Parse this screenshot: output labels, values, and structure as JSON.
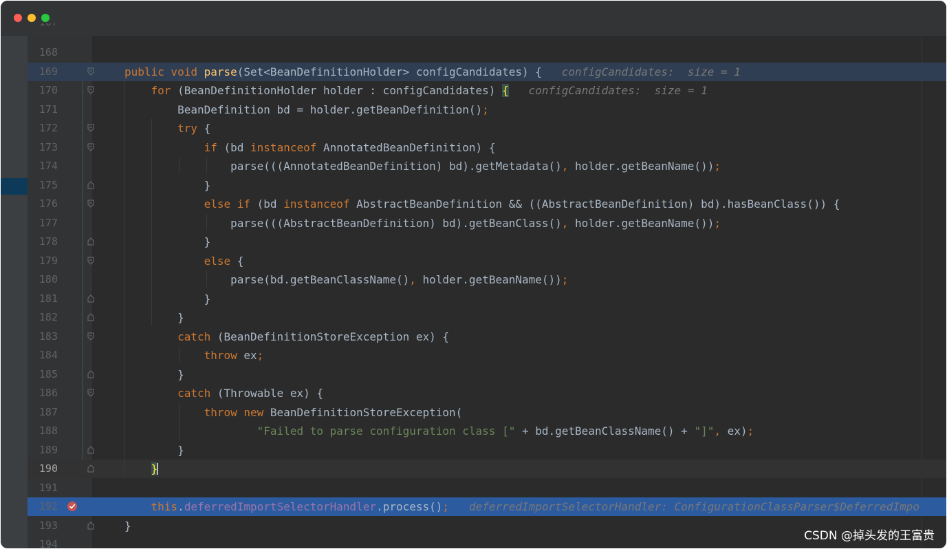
{
  "window": {
    "controls": [
      "close",
      "minimize",
      "zoom"
    ]
  },
  "editor": {
    "lines": [
      {
        "num": "168",
        "state": "normal",
        "fold": "none",
        "segs": []
      },
      {
        "num": "169",
        "state": "method",
        "fold": "open",
        "segs": [
          {
            "t": "public void ",
            "c": "kw"
          },
          {
            "t": "parse",
            "c": "fn"
          },
          {
            "t": "(Set<BeanDefinitionHolder> configCandidates) {   ",
            "c": ""
          },
          {
            "t": "configCandidates:  size = 1",
            "c": "hint"
          }
        ]
      },
      {
        "num": "170",
        "state": "normal",
        "fold": "open",
        "segs": [
          {
            "t": "    for ",
            "c": "kw"
          },
          {
            "t": "(BeanDefinitionHolder holder : configCandidates) ",
            "c": ""
          },
          {
            "t": "{",
            "c": "brace-match"
          },
          {
            "t": "   ",
            "c": ""
          },
          {
            "t": "configCandidates:  size = 1",
            "c": "hint"
          }
        ]
      },
      {
        "num": "171",
        "state": "normal",
        "fold": "none",
        "segs": [
          {
            "t": "        BeanDefinition bd = holder.getBeanDefinition()",
            "c": ""
          },
          {
            "t": ";",
            "c": "kw"
          }
        ]
      },
      {
        "num": "172",
        "state": "normal",
        "fold": "open",
        "segs": [
          {
            "t": "        try ",
            "c": "kw"
          },
          {
            "t": "{",
            "c": ""
          }
        ]
      },
      {
        "num": "173",
        "state": "normal",
        "fold": "open",
        "segs": [
          {
            "t": "            if ",
            "c": "kw"
          },
          {
            "t": "(bd ",
            "c": ""
          },
          {
            "t": "instanceof ",
            "c": "kw"
          },
          {
            "t": "AnnotatedBeanDefinition) {",
            "c": ""
          }
        ]
      },
      {
        "num": "174",
        "state": "normal",
        "fold": "none",
        "segs": [
          {
            "t": "                parse(((AnnotatedBeanDefinition) bd).getMetadata()",
            "c": ""
          },
          {
            "t": ", ",
            "c": "kw"
          },
          {
            "t": "holder.getBeanName())",
            "c": ""
          },
          {
            "t": ";",
            "c": "kw"
          }
        ]
      },
      {
        "num": "175",
        "state": "normal",
        "fold": "close",
        "segs": [
          {
            "t": "            }",
            "c": ""
          }
        ]
      },
      {
        "num": "176",
        "state": "normal",
        "fold": "open",
        "segs": [
          {
            "t": "            else if ",
            "c": "kw"
          },
          {
            "t": "(bd ",
            "c": ""
          },
          {
            "t": "instanceof ",
            "c": "kw"
          },
          {
            "t": "AbstractBeanDefinition && ((AbstractBeanDefinition) bd).hasBeanClass()) {",
            "c": ""
          }
        ]
      },
      {
        "num": "177",
        "state": "normal",
        "fold": "none",
        "segs": [
          {
            "t": "                parse(((AbstractBeanDefinition) bd).getBeanClass()",
            "c": ""
          },
          {
            "t": ", ",
            "c": "kw"
          },
          {
            "t": "holder.getBeanName())",
            "c": ""
          },
          {
            "t": ";",
            "c": "kw"
          }
        ]
      },
      {
        "num": "178",
        "state": "normal",
        "fold": "close",
        "segs": [
          {
            "t": "            }",
            "c": ""
          }
        ]
      },
      {
        "num": "179",
        "state": "normal",
        "fold": "open",
        "segs": [
          {
            "t": "            else ",
            "c": "kw"
          },
          {
            "t": "{",
            "c": ""
          }
        ]
      },
      {
        "num": "180",
        "state": "normal",
        "fold": "none",
        "segs": [
          {
            "t": "                parse(bd.getBeanClassName()",
            "c": ""
          },
          {
            "t": ", ",
            "c": "kw"
          },
          {
            "t": "holder.getBeanName())",
            "c": ""
          },
          {
            "t": ";",
            "c": "kw"
          }
        ]
      },
      {
        "num": "181",
        "state": "normal",
        "fold": "close",
        "segs": [
          {
            "t": "            }",
            "c": ""
          }
        ]
      },
      {
        "num": "182",
        "state": "normal",
        "fold": "close",
        "segs": [
          {
            "t": "        }",
            "c": ""
          }
        ]
      },
      {
        "num": "183",
        "state": "normal",
        "fold": "open",
        "segs": [
          {
            "t": "        catch ",
            "c": "kw"
          },
          {
            "t": "(BeanDefinitionStoreException ex) {",
            "c": ""
          }
        ]
      },
      {
        "num": "184",
        "state": "normal",
        "fold": "none",
        "segs": [
          {
            "t": "            throw ",
            "c": "kw"
          },
          {
            "t": "ex",
            "c": ""
          },
          {
            "t": ";",
            "c": "kw"
          }
        ]
      },
      {
        "num": "185",
        "state": "normal",
        "fold": "close",
        "segs": [
          {
            "t": "        }",
            "c": ""
          }
        ]
      },
      {
        "num": "186",
        "state": "normal",
        "fold": "open",
        "segs": [
          {
            "t": "        catch ",
            "c": "kw"
          },
          {
            "t": "(Throwable ex) {",
            "c": ""
          }
        ]
      },
      {
        "num": "187",
        "state": "normal",
        "fold": "none",
        "segs": [
          {
            "t": "            throw new ",
            "c": "kw"
          },
          {
            "t": "BeanDefinitionStoreException(",
            "c": ""
          }
        ]
      },
      {
        "num": "188",
        "state": "normal",
        "fold": "none",
        "segs": [
          {
            "t": "                    ",
            "c": ""
          },
          {
            "t": "\"Failed to parse configuration class [\"",
            "c": "str"
          },
          {
            "t": " + bd.getBeanClassName() + ",
            "c": ""
          },
          {
            "t": "\"]\"",
            "c": "str"
          },
          {
            "t": ", ",
            "c": "kw"
          },
          {
            "t": "ex)",
            "c": ""
          },
          {
            "t": ";",
            "c": "kw"
          }
        ]
      },
      {
        "num": "189",
        "state": "normal",
        "fold": "close",
        "segs": [
          {
            "t": "        }",
            "c": ""
          }
        ]
      },
      {
        "num": "190",
        "state": "caret",
        "fold": "close",
        "segs": [
          {
            "t": "    ",
            "c": ""
          },
          {
            "t": "}",
            "c": "brace-match"
          },
          {
            "t": "",
            "c": "caret"
          }
        ]
      },
      {
        "num": "191",
        "state": "normal",
        "fold": "none",
        "segs": []
      },
      {
        "num": "192",
        "state": "exec",
        "fold": "none",
        "breakpoint": true,
        "segs": [
          {
            "t": "    this",
            "c": "kw"
          },
          {
            "t": ".",
            "c": ""
          },
          {
            "t": "deferredImportSelectorHandler",
            "c": "fld"
          },
          {
            "t": ".process()",
            "c": ""
          },
          {
            "t": ";",
            "c": "kw"
          },
          {
            "t": "   ",
            "c": ""
          },
          {
            "t": "deferredImportSelectorHandler: ConfigurationClassParser$DeferredImpo",
            "c": "hint"
          }
        ]
      },
      {
        "num": "193",
        "state": "normal",
        "fold": "close",
        "segs": [
          {
            "t": "}",
            "c": ""
          }
        ]
      },
      {
        "num": "194",
        "state": "normal",
        "fold": "none",
        "segs": []
      }
    ],
    "partial_top_line": "167"
  },
  "watermark": "CSDN @掉头发的王富贵",
  "colors": {
    "keyword": "#cc7832",
    "function": "#ffc66d",
    "string": "#6a8759",
    "field": "#9876aa",
    "default": "#a9b7c6",
    "hint": "#787878",
    "exec_line": "#2d5ba0"
  }
}
